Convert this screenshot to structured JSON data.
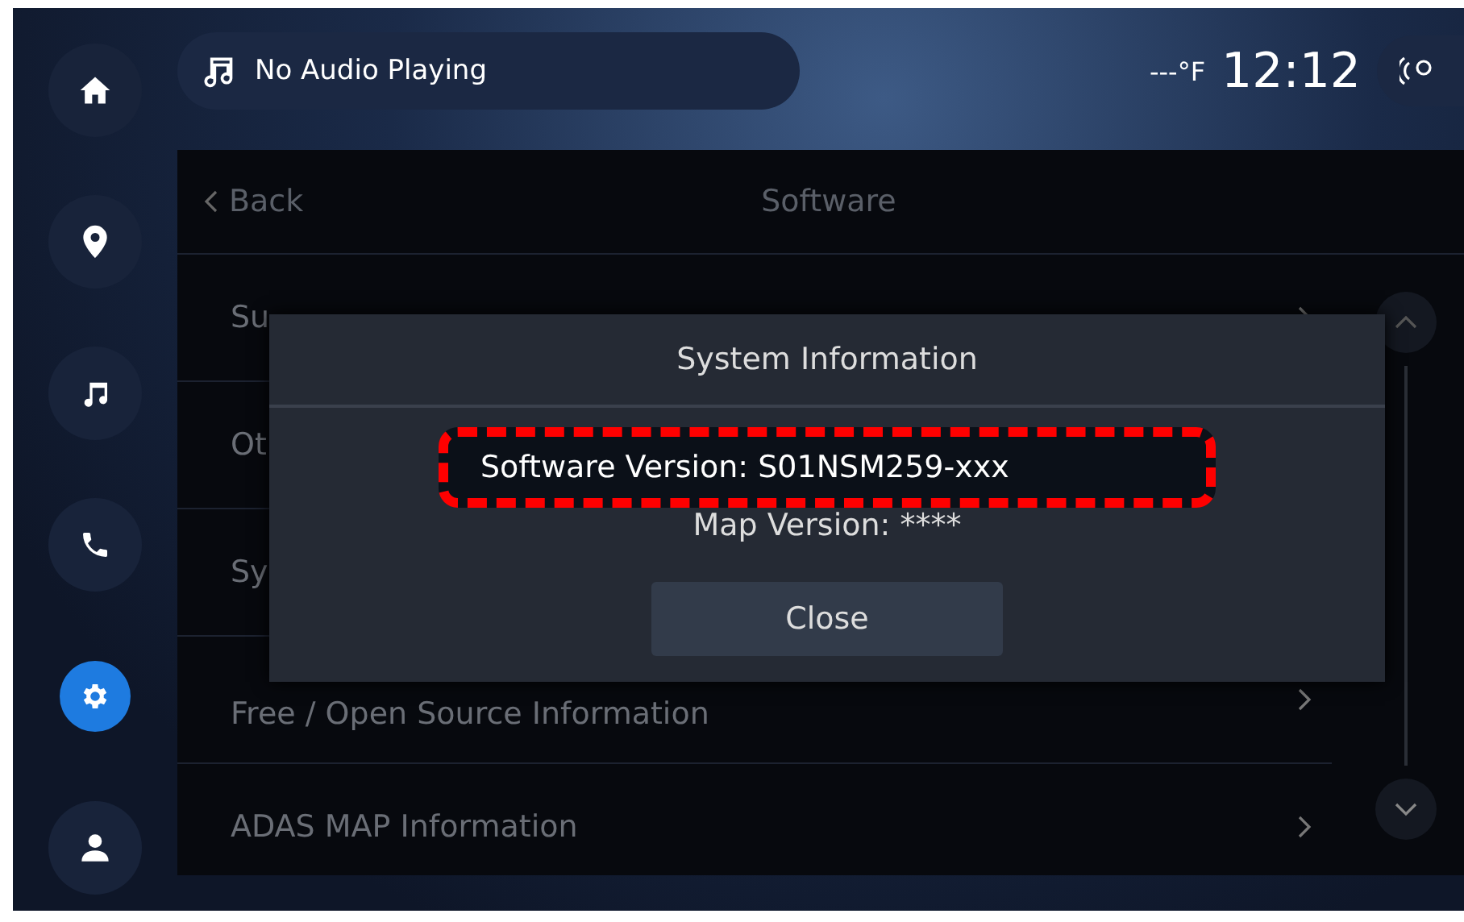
{
  "sidebar": {
    "items": [
      {
        "kind": "home",
        "selected": false
      },
      {
        "kind": "location",
        "selected": false
      },
      {
        "kind": "music",
        "selected": false
      },
      {
        "kind": "phone",
        "selected": false
      },
      {
        "kind": "settings",
        "selected": true
      },
      {
        "kind": "profile",
        "selected": false
      }
    ]
  },
  "status_bar": {
    "audio": "No Audio Playing",
    "temperature": "---°F",
    "time": "12:12"
  },
  "panel": {
    "back": "Back",
    "title": "Software",
    "rows": [
      {
        "label": "Su"
      },
      {
        "label": "Ot"
      },
      {
        "label": "Sy"
      },
      {
        "label": "Free / Open Source Information"
      },
      {
        "label": "ADAS MAP Information"
      }
    ]
  },
  "dialog": {
    "title": "System Information",
    "lines": [
      {
        "text": "Software Version: S01NSM259-xxx",
        "highlighted": true
      },
      {
        "text": "Map Version: ****",
        "highlighted": false
      }
    ],
    "button": "Close"
  }
}
